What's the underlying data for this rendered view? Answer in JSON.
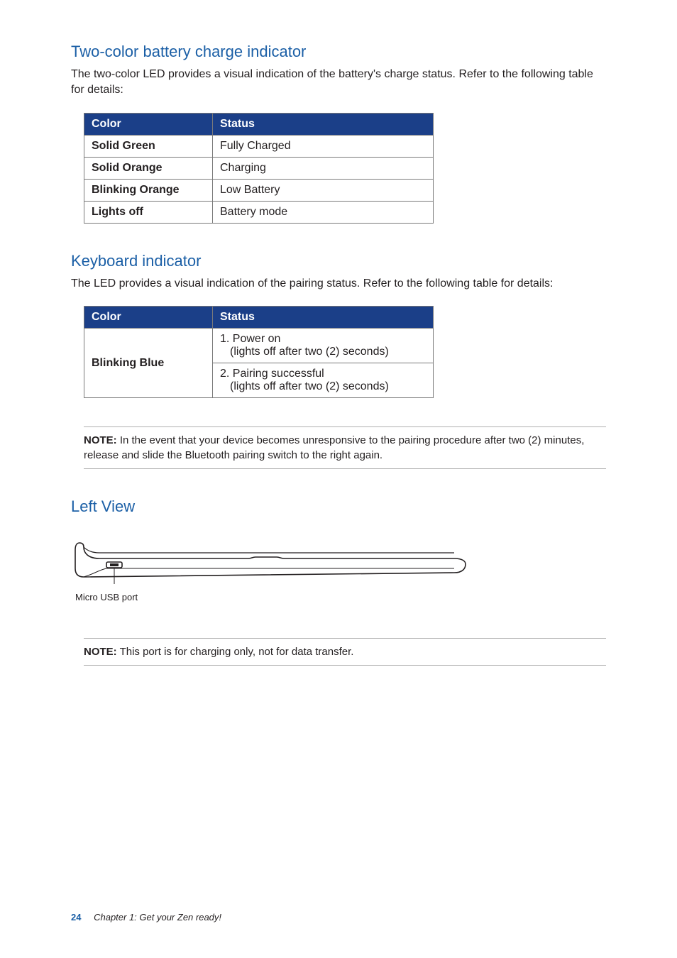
{
  "sections": {
    "battery": {
      "heading": "Two-color battery charge indicator",
      "intro": "The two-color LED provides a visual indication of the battery's charge status. Refer to the following table for details:",
      "headers": {
        "color": "Color",
        "status": "Status"
      },
      "rows": [
        {
          "color": "Solid Green",
          "status": "Fully Charged"
        },
        {
          "color": "Solid Orange",
          "status": "Charging"
        },
        {
          "color": "Blinking Orange",
          "status": "Low Battery"
        },
        {
          "color": "Lights off",
          "status": "Battery mode"
        }
      ]
    },
    "keyboard": {
      "heading": "Keyboard indicator",
      "intro": "The LED provides a visual indication of the pairing status. Refer to the following table for details:",
      "headers": {
        "color": "Color",
        "status": "Status"
      },
      "row_label": "Blinking Blue",
      "status1_line1": "1. Power on",
      "status1_line2": "(lights off after two (2) seconds)",
      "status2_line1": "2. Pairing successful",
      "status2_line2": "(lights off after two (2) seconds)"
    },
    "note1": {
      "label": "NOTE:",
      "text": " In the event that your device becomes unresponsive to the pairing procedure after two (2) minutes, release and slide the Bluetooth pairing switch to the right again."
    },
    "leftview": {
      "heading": "Left View",
      "usb_label": "Micro USB port"
    },
    "note2": {
      "label": "NOTE:",
      "text": " This port is for charging only, not for data transfer."
    }
  },
  "footer": {
    "page": "24",
    "chapter": "Chapter 1: Get your Zen ready!"
  }
}
